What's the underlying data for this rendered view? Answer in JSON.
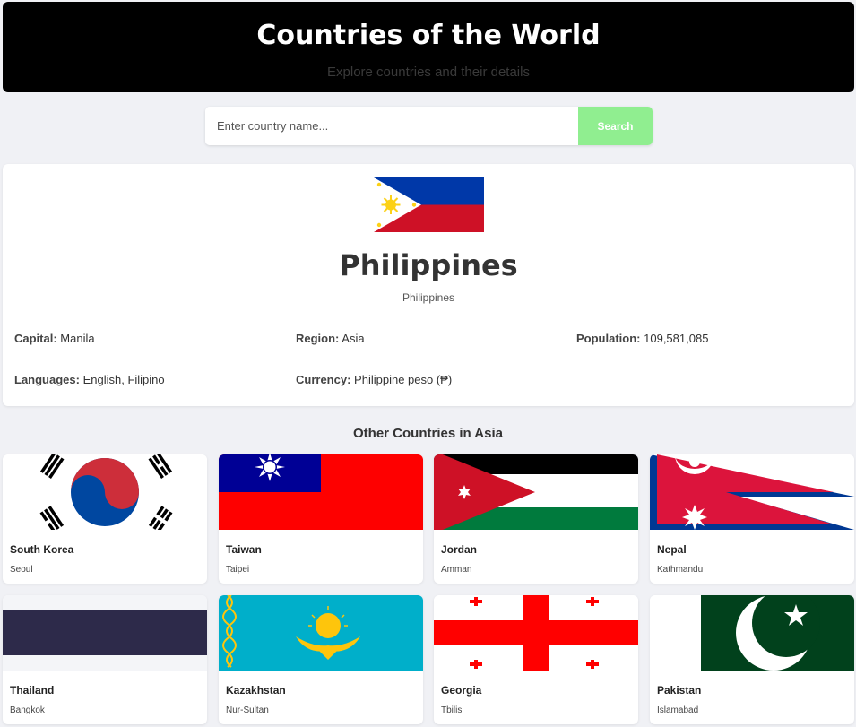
{
  "header": {
    "title": "Countries of the World",
    "subtitle": "Explore countries and their details"
  },
  "search": {
    "placeholder": "Enter country name...",
    "value": "",
    "button_label": "Search",
    "button_color": "#90ee90"
  },
  "selected": {
    "name": "Philippines",
    "official_name": "Philippines",
    "capital_label": "Capital:",
    "capital": "Manila",
    "region_label": "Region:",
    "region": "Asia",
    "population_label": "Population:",
    "population": "109,581,085",
    "languages_label": "Languages:",
    "languages": "English, Filipino",
    "currency_label": "Currency:",
    "currency": "Philippine peso (₱)",
    "flag_icon": "philippines-flag"
  },
  "others": {
    "title": "Other Countries in Asia",
    "countries": [
      {
        "name": "South Korea",
        "capital": "Seoul",
        "flag_icon": "south-korea-flag"
      },
      {
        "name": "Taiwan",
        "capital": "Taipei",
        "flag_icon": "taiwan-flag"
      },
      {
        "name": "Jordan",
        "capital": "Amman",
        "flag_icon": "jordan-flag"
      },
      {
        "name": "Nepal",
        "capital": "Kathmandu",
        "flag_icon": "nepal-flag"
      },
      {
        "name": "Thailand",
        "capital": "Bangkok",
        "flag_icon": "thailand-flag"
      },
      {
        "name": "Kazakhstan",
        "capital": "Nur-Sultan",
        "flag_icon": "kazakhstan-flag"
      },
      {
        "name": "Georgia",
        "capital": "Tbilisi",
        "flag_icon": "georgia-flag"
      },
      {
        "name": "Pakistan",
        "capital": "Islamabad",
        "flag_icon": "pakistan-flag"
      }
    ]
  }
}
